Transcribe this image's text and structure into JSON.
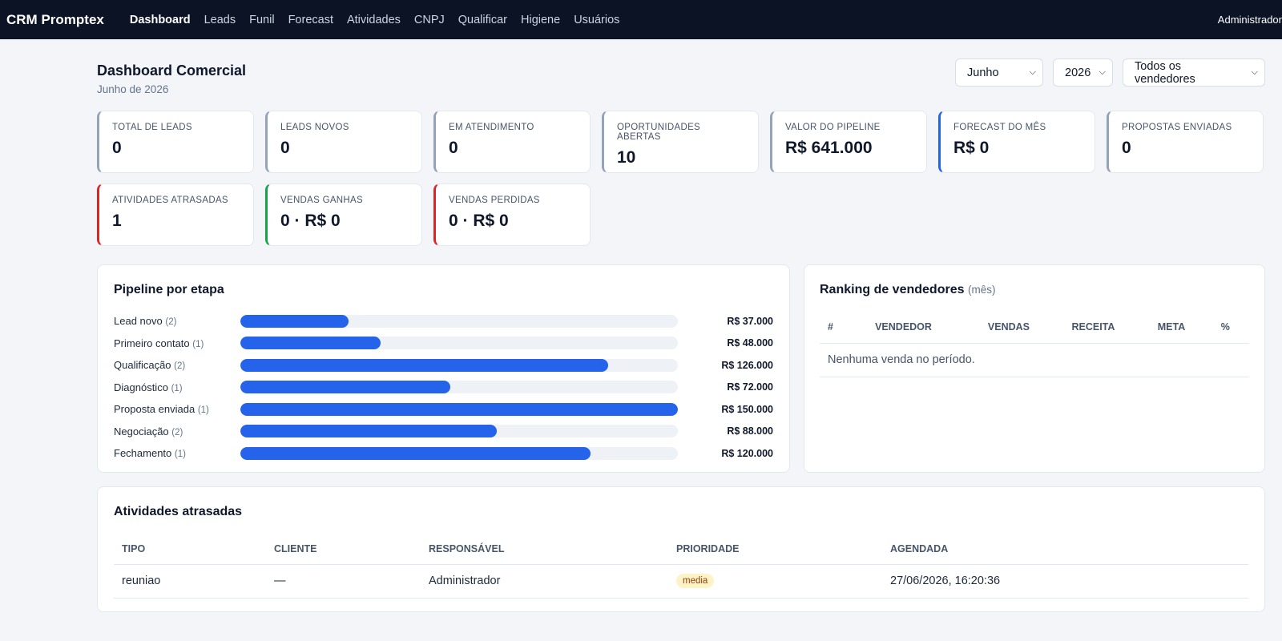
{
  "app": {
    "brand": "CRM Promptex",
    "nav": [
      "Dashboard",
      "Leads",
      "Funil",
      "Forecast",
      "Atividades",
      "CNPJ",
      "Qualificar",
      "Higiene",
      "Usuários"
    ],
    "active_nav": "Dashboard",
    "user": "Administrador"
  },
  "header": {
    "title": "Dashboard Comercial",
    "subtitle": "Junho de 2026",
    "filters": {
      "month": "Junho",
      "year": "2026",
      "seller": "Todos os vendedores"
    }
  },
  "kpis": [
    {
      "label": "Total de leads",
      "value": "0",
      "accent": "#94a3b8"
    },
    {
      "label": "Leads novos",
      "value": "0",
      "accent": "#94a3b8"
    },
    {
      "label": "Em atendimento",
      "value": "0",
      "accent": "#94a3b8"
    },
    {
      "label": "Oportunidades abertas",
      "value": "10",
      "accent": "#94a3b8"
    },
    {
      "label": "Valor do pipeline",
      "value": "R$ 641.000",
      "accent": "#94a3b8"
    },
    {
      "label": "Forecast do mês",
      "value": "R$ 0",
      "accent": "#2563eb"
    },
    {
      "label": "Propostas enviadas",
      "value": "0",
      "accent": "#94a3b8"
    },
    {
      "label": "Atividades atrasadas",
      "value": "1",
      "accent": "#dc2626"
    },
    {
      "label": "Vendas ganhas",
      "value": "0 · R$ 0",
      "accent": "#16a34a"
    },
    {
      "label": "Vendas perdidas",
      "value": "0 · R$ 0",
      "accent": "#dc2626"
    }
  ],
  "pipeline": {
    "title": "Pipeline por etapa",
    "bar_color": "#2563eb",
    "stages": [
      {
        "name": "Lead novo",
        "count": "(2)",
        "value": "R$ 37.000",
        "amount": 37000
      },
      {
        "name": "Primeiro contato",
        "count": "(1)",
        "value": "R$ 48.000",
        "amount": 48000
      },
      {
        "name": "Qualificação",
        "count": "(2)",
        "value": "R$ 126.000",
        "amount": 126000
      },
      {
        "name": "Diagnóstico",
        "count": "(1)",
        "value": "R$ 72.000",
        "amount": 72000
      },
      {
        "name": "Proposta enviada",
        "count": "(1)",
        "value": "R$ 150.000",
        "amount": 150000
      },
      {
        "name": "Negociação",
        "count": "(2)",
        "value": "R$ 88.000",
        "amount": 88000
      },
      {
        "name": "Fechamento",
        "count": "(1)",
        "value": "R$ 120.000",
        "amount": 120000
      }
    ]
  },
  "ranking": {
    "title": "Ranking de vendedores",
    "title_suffix": "(mês)",
    "columns": [
      "#",
      "Vendedor",
      "Vendas",
      "Receita",
      "Meta",
      "%"
    ],
    "empty": "Nenhuma venda no período."
  },
  "late": {
    "title": "Atividades atrasadas",
    "columns": [
      "Tipo",
      "Cliente",
      "Responsável",
      "Prioridade",
      "Agendada"
    ],
    "rows": [
      {
        "tipo": "reuniao",
        "cliente": "—",
        "responsavel": "Administrador",
        "prioridade": "media",
        "agendada": "27/06/2026, 16:20:36"
      }
    ]
  }
}
